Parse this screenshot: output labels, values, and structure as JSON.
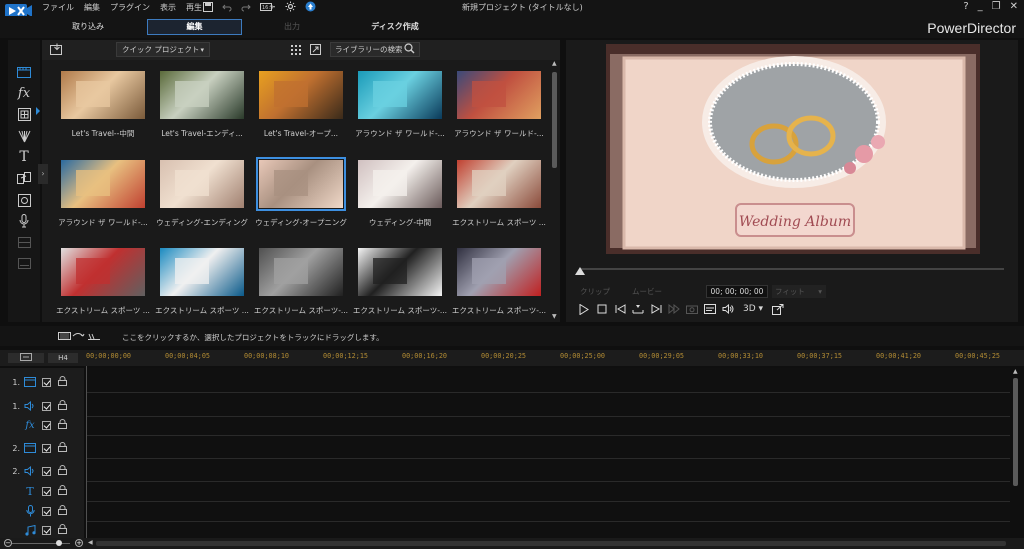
{
  "app": {
    "menu": [
      "ファイル",
      "編集",
      "プラグイン",
      "表示",
      "再生"
    ],
    "window_title": "新規プロジェクト (タイトルなし)",
    "brand": "PowerDirector",
    "window_controls": [
      "?",
      "_",
      "❐",
      "✕"
    ]
  },
  "modes": {
    "capture": "取り込み",
    "edit": "編集",
    "output": "出力",
    "disc": "ディスク作成"
  },
  "library": {
    "dropdown_value": "クイック プロジェクト",
    "search_placeholder": "ライブラリーの検索",
    "items": [
      {
        "label": "Let's Travel--中間",
        "colors": [
          "#b07a4a",
          "#e8c8a0",
          "#7a5a3a"
        ]
      },
      {
        "label": "Let's Travel-エンディ...",
        "colors": [
          "#5a6a3a",
          "#c8d0c0",
          "#2a3a2a"
        ]
      },
      {
        "label": "Let's Travel-オープ...",
        "colors": [
          "#e8a020",
          "#c07030",
          "#3a2a1a"
        ]
      },
      {
        "label": "アラウンド ザ ワールド-...",
        "colors": [
          "#1a9ab8",
          "#6ad0e0",
          "#0a3a5a"
        ]
      },
      {
        "label": "アラウンド ザ ワールド-...",
        "colors": [
          "#3a4a7a",
          "#c05040",
          "#e0a060"
        ]
      },
      {
        "label": "アラウンド ザ ワールド-...",
        "colors": [
          "#2a6aa0",
          "#e8c080",
          "#c04030"
        ]
      },
      {
        "label": "ウェディング-エンディング",
        "colors": [
          "#d8c0b0",
          "#f0e0d0",
          "#a08070"
        ]
      },
      {
        "label": "ウェディング-オープニング",
        "colors": [
          "#e8c8b8",
          "#a89080",
          "#f0d8c8"
        ]
      },
      {
        "label": "ウェディング-中間",
        "colors": [
          "#d0c0c0",
          "#f4f0ec",
          "#6a5a5a"
        ]
      },
      {
        "label": "エクストリーム スポーツ ...",
        "colors": [
          "#c04030",
          "#e0d0c0",
          "#8a4a3a"
        ]
      },
      {
        "label": "エクストリーム スポーツ ...",
        "colors": [
          "#e0e0e0",
          "#c03030",
          "#606060"
        ]
      },
      {
        "label": "エクストリーム スポーツ ...",
        "colors": [
          "#1a8ac0",
          "#f0f0f0",
          "#0a5a8a"
        ]
      },
      {
        "label": "エクストリーム スポーツ-...",
        "colors": [
          "#505050",
          "#a0a0a0",
          "#202020"
        ]
      },
      {
        "label": "エクストリーム スポーツ-...",
        "colors": [
          "#f4f4f4",
          "#202020",
          "#f4f4f4"
        ]
      },
      {
        "label": "エクストリーム スポーツ-...",
        "colors": [
          "#303040",
          "#a0a0b0",
          "#c02020"
        ]
      }
    ],
    "selected_index": 7
  },
  "preview": {
    "caption": "Wedding Album",
    "mode_clip": "クリップ",
    "mode_movie": "ムービー",
    "timecode": "00; 00; 00; 00",
    "fit": "フィット",
    "three_d": "3D"
  },
  "timeline": {
    "hint": "ここをクリックするか、選択したプロジェクトをトラックにドラッグします。",
    "h4_label": "H4",
    "ruler": [
      "00;00;00;00",
      "00;00;04;05",
      "00;00;08;10",
      "00;00;12;15",
      "00;00;16;20",
      "00;00;20;25",
      "00;00;25;00",
      "00;00;29;05",
      "00;00;33;10",
      "00;00;37;15",
      "00;00;41;20",
      "00;00;45;25"
    ],
    "tracks": [
      {
        "num": "1.",
        "icon": "video-track-icon"
      },
      {
        "num": "1.",
        "icon": "audio-track-icon"
      },
      {
        "num": "",
        "icon": "fx-track-icon"
      },
      {
        "num": "2.",
        "icon": "video-track-icon"
      },
      {
        "num": "2.",
        "icon": "audio-track-icon"
      },
      {
        "num": "",
        "icon": "title-track-icon"
      },
      {
        "num": "",
        "icon": "voice-track-icon"
      },
      {
        "num": "",
        "icon": "music-track-icon"
      }
    ]
  },
  "colors": {
    "accent": "#3d8fe0",
    "ruler_text": "#b08a33"
  }
}
